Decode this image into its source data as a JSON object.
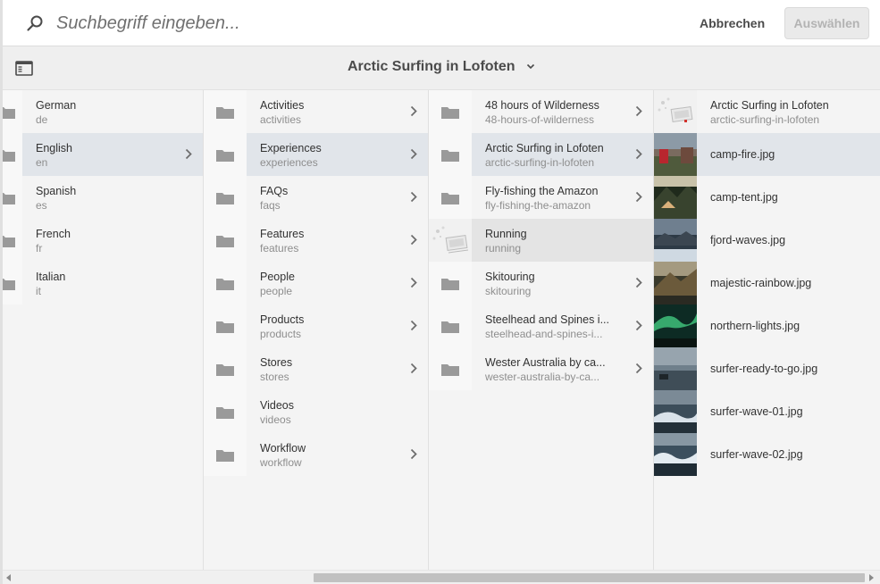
{
  "search": {
    "placeholder": "Suchbegriff eingeben...",
    "cancel_label": "Abbrechen",
    "select_label": "Auswählen"
  },
  "header": {
    "title": "Arctic Surfing in Lofoten"
  },
  "columns": {
    "languages": [
      {
        "title": "German",
        "sub": "de"
      },
      {
        "title": "English",
        "sub": "en"
      },
      {
        "title": "Spanish",
        "sub": "es"
      },
      {
        "title": "French",
        "sub": "fr"
      },
      {
        "title": "Italian",
        "sub": "it"
      }
    ],
    "sections": [
      {
        "title": "Activities",
        "sub": "activities"
      },
      {
        "title": "Experiences",
        "sub": "experiences"
      },
      {
        "title": "FAQs",
        "sub": "faqs"
      },
      {
        "title": "Features",
        "sub": "features"
      },
      {
        "title": "People",
        "sub": "people"
      },
      {
        "title": "Products",
        "sub": "products"
      },
      {
        "title": "Stores",
        "sub": "stores"
      },
      {
        "title": "Videos",
        "sub": "videos"
      },
      {
        "title": "Workflow",
        "sub": "workflow"
      }
    ],
    "experiences": [
      {
        "title": "48 hours of Wilderness",
        "sub": "48-hours-of-wilderness"
      },
      {
        "title": "Arctic Surfing in Lofoten",
        "sub": "arctic-surfing-in-lofoten"
      },
      {
        "title": "Fly-fishing the Amazon",
        "sub": "fly-fishing-the-amazon"
      },
      {
        "title": "Running",
        "sub": "running"
      },
      {
        "title": "Skitouring",
        "sub": "skitouring"
      },
      {
        "title": "Steelhead and Spines i...",
        "sub": "steelhead-and-spines-i..."
      },
      {
        "title": "Wester Australia by ca...",
        "sub": "wester-australia-by-ca..."
      }
    ],
    "assets": [
      {
        "title": "Arctic Surfing in Lofoten",
        "sub": "arctic-surfing-in-lofoten"
      },
      {
        "title": "camp-fire.jpg"
      },
      {
        "title": "camp-tent.jpg"
      },
      {
        "title": "fjord-waves.jpg"
      },
      {
        "title": "majestic-rainbow.jpg"
      },
      {
        "title": "northern-lights.jpg"
      },
      {
        "title": "surfer-ready-to-go.jpg"
      },
      {
        "title": "surfer-wave-01.jpg"
      },
      {
        "title": "surfer-wave-02.jpg"
      }
    ]
  },
  "colors": {
    "selected_row": "#e1e5ea",
    "active_row": "#e4e4e4",
    "background": "#f4f4f4"
  },
  "icons": {
    "search": "search-icon",
    "rail": "rail-toggle-icon",
    "folder": "folder-icon",
    "chevron": "chevron-right-icon"
  }
}
